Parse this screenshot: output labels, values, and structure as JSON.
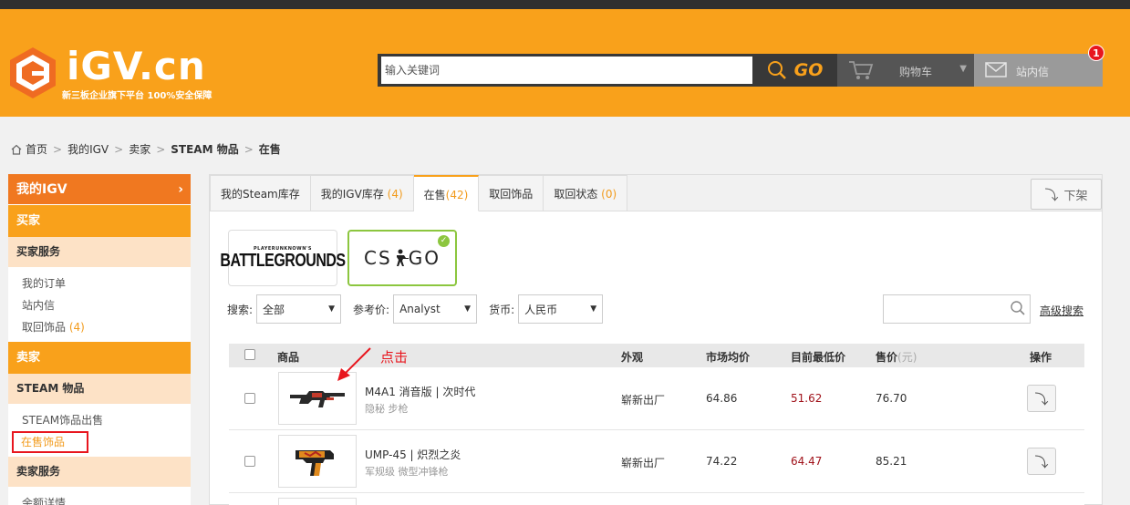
{
  "header": {
    "logo_text": "iGV.cn",
    "slogan": "新三板企业旗下平台 100%安全保障",
    "search_placeholder": "输入关键词",
    "go_label": "GO",
    "cart_label": "购物车",
    "inbox_label": "站内信",
    "inbox_badge": "1",
    "brand_color": "#f9a11b"
  },
  "breadcrumb": [
    "首页",
    "我的IGV",
    "卖家",
    "STEAM 物品",
    "在售"
  ],
  "sidebar": {
    "main": "我的IGV",
    "buyer_section": "买家",
    "buyer_service": "买家服务",
    "buyer_links": [
      {
        "label": "我的订单",
        "count": ""
      },
      {
        "label": "站内信",
        "count": ""
      },
      {
        "label": "取回饰品",
        "count": "(4)"
      }
    ],
    "seller_section": "卖家",
    "steam_items": "STEAM 物品",
    "steam_links": [
      "STEAM饰品出售",
      "在售饰品"
    ],
    "seller_service": "卖家服务",
    "seller_links": [
      "余额详情"
    ]
  },
  "tabs": [
    {
      "label": "我的Steam库存",
      "count": ""
    },
    {
      "label": "我的IGV库存",
      "count": "(4)"
    },
    {
      "label": "在售",
      "count": "(42)"
    },
    {
      "label": "取回饰品",
      "count": ""
    },
    {
      "label": "取回状态",
      "count": "(0)"
    }
  ],
  "offshelf_label": "下架",
  "games": {
    "pubg_top": "PLAYERUNKNOWN'S",
    "pubg_main": "BATTLEGROUNDS",
    "csgo_left": "CS",
    "csgo_right": "GO"
  },
  "filters": {
    "search_label": "搜索:",
    "search_value": "全部",
    "ref_label": "参考价:",
    "ref_value": "Analyst",
    "currency_label": "货币:",
    "currency_value": "人民币",
    "advanced_label": "高级搜索"
  },
  "table": {
    "headers": {
      "item": "商品",
      "exterior": "外观",
      "market": "市场均价",
      "lowest": "目前最低价",
      "price": "售价",
      "price_unit": "(元)",
      "action": "操作"
    },
    "rows": [
      {
        "name": "M4A1 消音版 | 次时代",
        "sub": "隐秘 步枪",
        "exterior": "崭新出厂",
        "market": "64.86",
        "lowest": "51.62",
        "price": "76.70"
      },
      {
        "name": "UMP-45 | 炽烈之炎",
        "sub": "军规级 微型冲锋枪",
        "exterior": "崭新出厂",
        "market": "74.22",
        "lowest": "64.47",
        "price": "85.21"
      }
    ]
  },
  "annotation": "点击"
}
